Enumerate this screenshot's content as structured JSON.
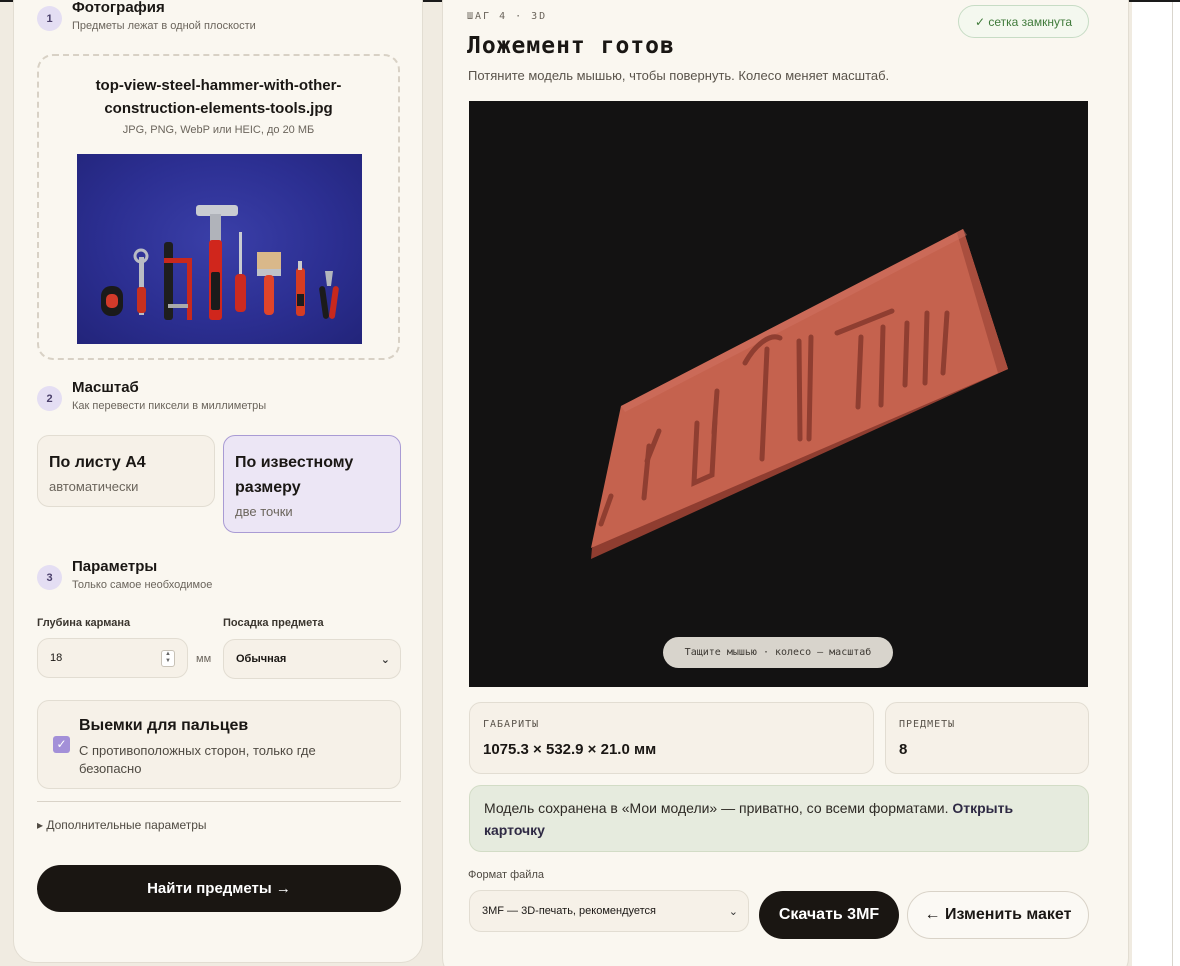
{
  "left": {
    "step1": {
      "num": "1",
      "title": "Фотография",
      "sub": "Предметы лежат в одной плоскости"
    },
    "upload": {
      "filename": "top-view-steel-hammer-with-other-construction-elements-tools.jpg",
      "hint": "JPG, PNG, WebP или HEIC, до 20 МБ"
    },
    "step2": {
      "num": "2",
      "title": "Масштаб",
      "sub": "Как перевести пиксели в миллиметры"
    },
    "scale_options": [
      {
        "title": "По листу A4",
        "sub": "автоматически",
        "selected": false
      },
      {
        "title": "По известному размеру",
        "sub": "две точки",
        "selected": true
      }
    ],
    "step3": {
      "num": "3",
      "title": "Параметры",
      "sub": "Только самое необходимое"
    },
    "depth": {
      "label": "Глубина кармана",
      "value": "18",
      "unit": "мм"
    },
    "fit": {
      "label": "Посадка предмета",
      "value": "Обычная"
    },
    "fingers": {
      "title": "Выемки для пальцев",
      "sub": "С противоположных сторон, только где безопасно",
      "checked": true
    },
    "more": "▸ Дополнительные параметры",
    "find_button": "Найти предметы →"
  },
  "right": {
    "step_label": "ШАГ 4 · 3D",
    "badge": "✓ сетка замкнута",
    "title": "Ложемент готов",
    "sub": "Потяните модель мышью, чтобы повернуть. Колесо меняет масштаб.",
    "viewer_hint": "Тащите мышью · колесо — масштаб",
    "dims": {
      "label": "ГАБАРИТЫ",
      "value": "1075.3 × 532.9 × 21.0 мм"
    },
    "items": {
      "label": "ПРЕДМЕТЫ",
      "value": "8"
    },
    "saved_text": "Модель сохранена в «Мои модели» — приватно, со всеми форматами.",
    "saved_link": "Открыть карточку",
    "format_label": "Формат файла",
    "format_value": "3MF — 3D-печать, рекомендуется",
    "download_button": "Скачать 3MF",
    "edit_button": "← Изменить макет"
  },
  "colors": {
    "accent": "#a390d8",
    "dark_button": "#1a1612",
    "model": "#c5624e",
    "success": "#3f7a3a"
  }
}
